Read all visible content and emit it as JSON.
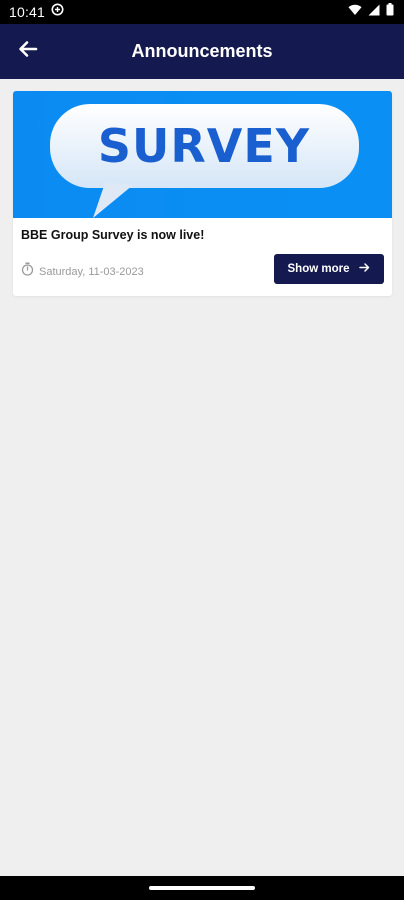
{
  "status_bar": {
    "time": "10:41",
    "icons": [
      "sync-icon",
      "wifi-icon",
      "signal-icon",
      "battery-icon"
    ]
  },
  "app_bar": {
    "title": "Announcements",
    "back_icon": "arrow-left-icon"
  },
  "announcements": [
    {
      "banner_text": "SURVEY",
      "title": "BBE Group Survey is now live!",
      "date": "Saturday, 11-03-2023",
      "button_label": "Show more",
      "button_icon": "arrow-right-icon"
    }
  ],
  "colors": {
    "app_bar": "#141a4f",
    "background": "#efefef",
    "banner_blue": "#0a8cf4",
    "banner_text": "#1a5fd0"
  }
}
